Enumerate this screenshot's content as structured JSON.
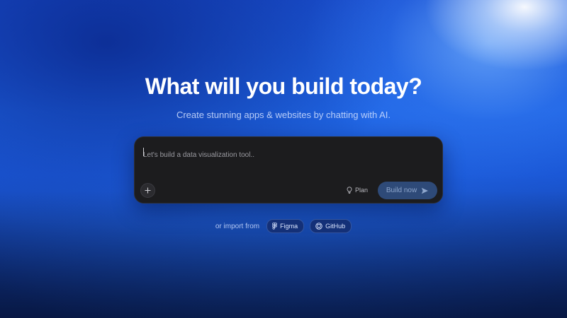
{
  "hero": {
    "title": "What will you build today?",
    "subtitle": "Create stunning apps & websites by chatting with AI."
  },
  "prompt": {
    "placeholder": "Let's build a data visualization tool..",
    "attach_icon": "plus-icon",
    "plan_label": "Plan",
    "plan_icon": "lightbulb-icon",
    "build_label": "Build now",
    "build_icon": "send-arrow-icon"
  },
  "import": {
    "label": "or import from",
    "sources": [
      {
        "label": "Figma",
        "icon": "figma-icon"
      },
      {
        "label": "GitHub",
        "icon": "github-icon"
      }
    ]
  },
  "colors": {
    "background_top": "#1a4fd0",
    "background_bottom": "#0c2460",
    "prompt_bg": "#1c1c1e",
    "build_button_bg": "#2e4a78",
    "pill_bg": "#142d6e"
  }
}
